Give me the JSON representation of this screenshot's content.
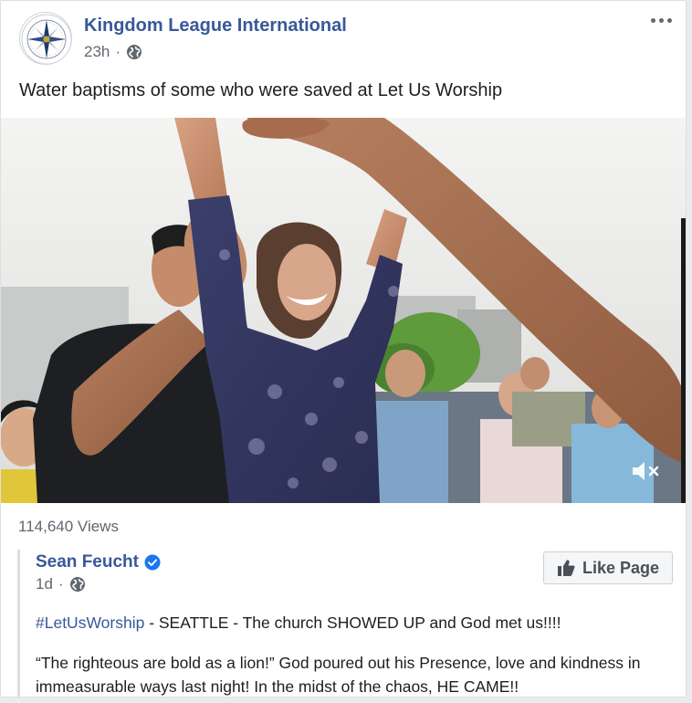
{
  "post": {
    "page_name": "Kingdom League International",
    "time": "23h",
    "separator": "·",
    "text": "Water baptisms of some who were saved at Let Us Worship",
    "views": "114,640 Views"
  },
  "shared_post": {
    "author": "Sean Feucht",
    "time": "1d",
    "separator": "·",
    "like_button_label": "Like Page",
    "hashtag": "#LetUsWorship",
    "line1_rest": " - SEATTLE - The church SHOWED UP and God met us!!!!",
    "line2": "“The righteous are bold as a lion!” God poured out his Presence, love and kindness in immeasurable ways last night! In the midst of the chaos, HE CAME!!"
  },
  "icons": {
    "avatar": "compass-logo-icon",
    "privacy": "globe-icon",
    "more": "more-options-icon",
    "verified": "verified-badge-icon",
    "like": "thumbs-up-icon",
    "mute": "speaker-muted-icon"
  },
  "colors": {
    "link": "#385898",
    "secondary_text": "#606770",
    "verified": "#1877f2"
  }
}
